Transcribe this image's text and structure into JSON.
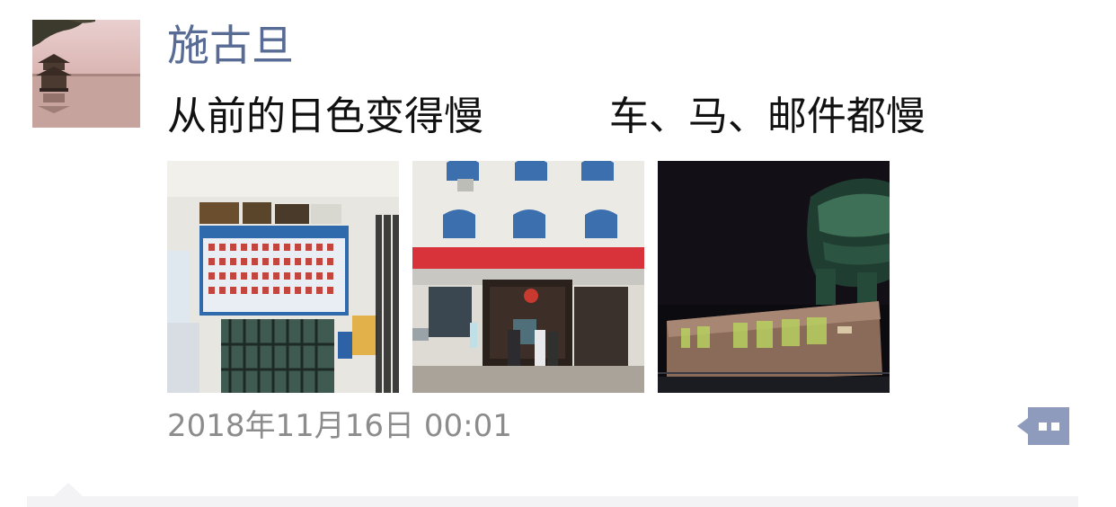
{
  "post": {
    "author": "施古旦",
    "text": "从前的日色变得慢          车、马、邮件都慢",
    "timestamp": "2018年11月16日 00:01",
    "photo_count": 3
  },
  "icons": {
    "comment": "comment-more-icon"
  },
  "colors": {
    "author_name": "#576b95",
    "timestamp": "#8c8c8c",
    "comment_button": "#8e9bbd",
    "comment_area": "#f3f3f5"
  }
}
